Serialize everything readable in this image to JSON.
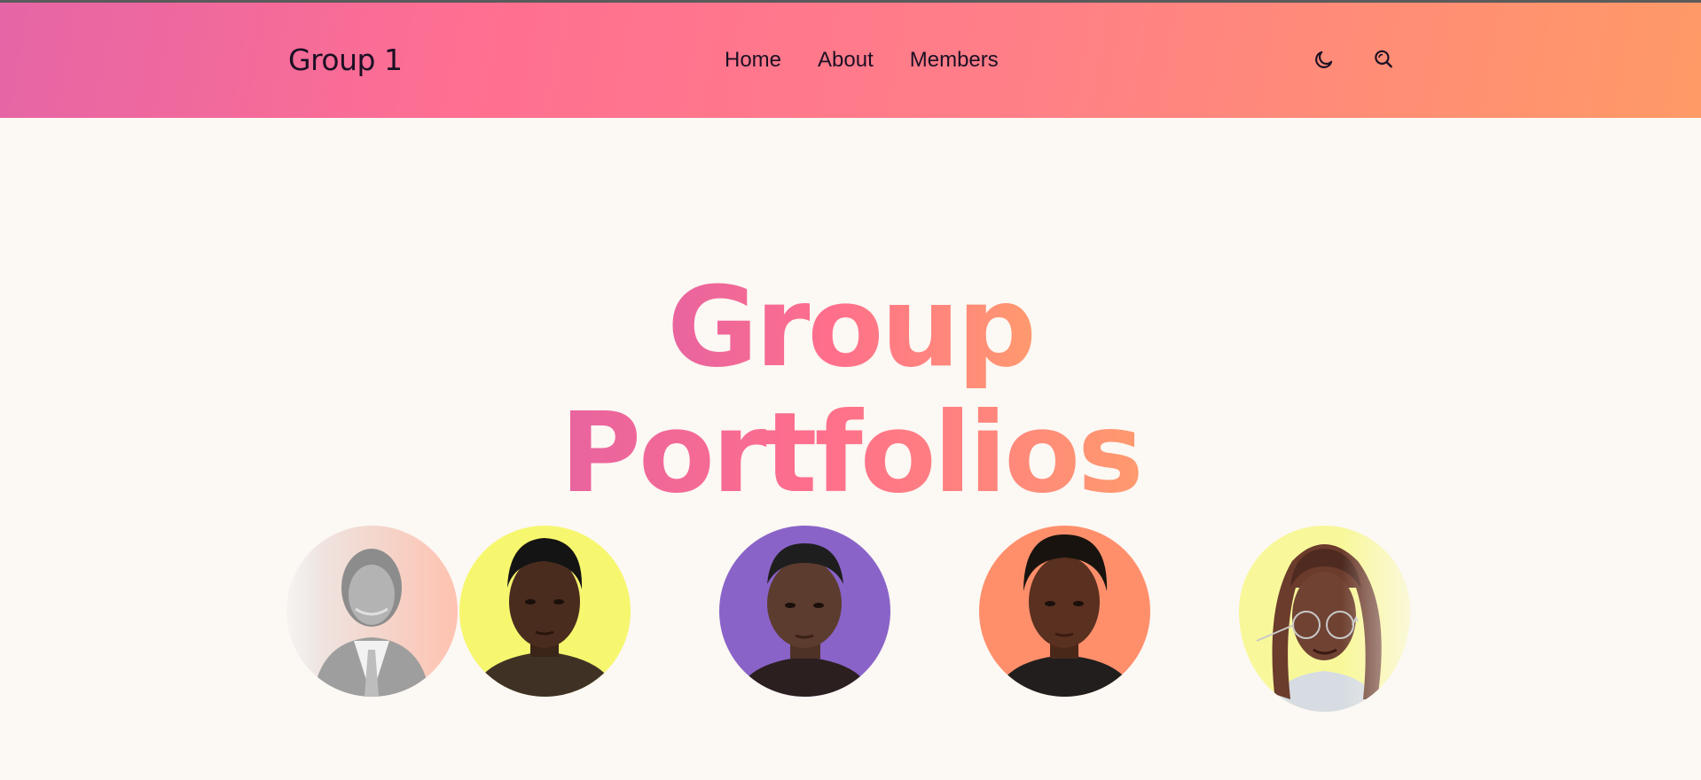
{
  "header": {
    "logo": "Group 1",
    "nav": [
      "Home",
      "About",
      "Members"
    ],
    "icons": [
      "moon-icon",
      "search-icon"
    ]
  },
  "hero": {
    "line1": "Group",
    "line2": "Portfolios"
  },
  "members": [
    {
      "name": "member-1",
      "bg": "#ffc5b6",
      "skin": "#9a9a9a",
      "hair": "#777777",
      "shirt": "#ececec",
      "faded": true,
      "gray": true
    },
    {
      "name": "member-2",
      "bg": "#f7f76f",
      "skin": "#4a2c1f",
      "hair": "#161616",
      "shirt": "#403325",
      "faded": false,
      "gray": false
    },
    {
      "name": "member-3",
      "bg": "#8a63c8",
      "skin": "#5c3c2e",
      "hair": "#202020",
      "shirt": "#2e2222",
      "faded": false,
      "gray": false
    },
    {
      "name": "member-4",
      "bg": "#ff8f6b",
      "skin": "#5a3020",
      "hair": "#1a1512",
      "shirt": "#23201f",
      "faded": false,
      "gray": false
    },
    {
      "name": "member-5",
      "bg": "#f8f89a",
      "skin": "#6a3f2f",
      "hair": "#4a2a21",
      "shirt": "#d6dce2",
      "faded": true,
      "gray": false
    }
  ],
  "colors": {
    "header_gradient": [
      "#e565a6",
      "#ff6f91",
      "#ff9a66"
    ],
    "page_bg": "#fcf8f4",
    "text": "#1c1024"
  }
}
